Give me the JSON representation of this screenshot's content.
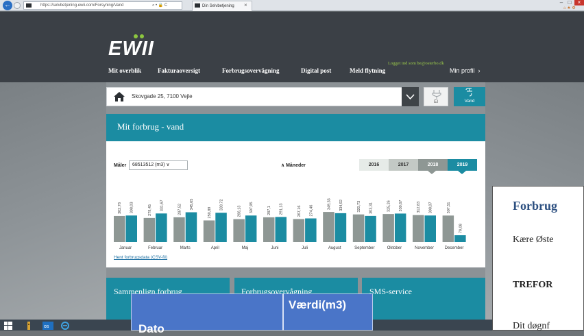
{
  "browser": {
    "url": "https://selvbetjening.ewii.com/Forsyning/Vand",
    "url_controls": "⌕ • 🔒 C",
    "tab_title": "Din Selvbetjening",
    "tab_close": "×"
  },
  "header": {
    "logo": "EWII",
    "nav": [
      "Mit overblik",
      "Fakturaoversigt",
      "Forbrugsovervågning",
      "Digital post",
      "Meld flytning"
    ],
    "login_text": "Logget ind som be@osterbo.dk",
    "profile": "Min profil",
    "profile_chevron": "›"
  },
  "address": {
    "text": "Skovgade 25, 7100 Vejle",
    "el_label": "El",
    "vand_label": "Vand"
  },
  "panel": {
    "title": "Mit forbrug - vand",
    "maaler_label": "Måler",
    "maaler_value": "68513512 (m3) ∨",
    "maaneder": "∧ Måneder",
    "years": [
      "2016",
      "2017",
      "2018",
      "2019"
    ],
    "csv_link": "Hent forbrugsdata (CSV-fil)"
  },
  "colors": {
    "teal": "#1b8ca2",
    "gray_bar": "#8e9794",
    "year_2016_bg": "#e6ebe8",
    "year_2017_bg": "#c3c9c5",
    "year_2018_bg": "#8e9794",
    "year_2019_bg": "#1b8ca2"
  },
  "chart_data": {
    "type": "bar",
    "categories": [
      "Januar",
      "Februar",
      "Marts",
      "April",
      "Maj",
      "Juni",
      "Juli",
      "August",
      "September",
      "Oktober",
      "November",
      "December"
    ],
    "series": [
      {
        "values": [
          302.78,
          279.45,
          287.52,
          250.89,
          266.13,
          287.1,
          267.16,
          349.33,
          320.73,
          325.26,
          312.83,
          307.51
        ]
      },
      {
        "values": [
          308.03,
          331.67,
          345.65,
          339.72,
          307.95,
          291.13,
          274.46,
          334.92,
          303.31,
          330.67,
          308.07,
          79.08
        ]
      }
    ],
    "data_labels": {
      "series_0": [
        "302,78",
        "279,45",
        "287,52",
        "250,89",
        "266,13",
        "287,1",
        "267,16",
        "349,33",
        "320,73",
        "325,26",
        "312,83",
        "307,51"
      ],
      "series_1": [
        "308,03",
        "331,67",
        "345,65",
        "339,72",
        "307,95",
        "291,13",
        "274,46",
        "334,92",
        "303,31",
        "330,67",
        "308,07",
        "79,08"
      ]
    },
    "title": "",
    "xlabel": "",
    "ylabel": "",
    "ylim": [
      0,
      360
    ],
    "grid": false
  },
  "tiles": [
    "Sammenlign forbrug",
    "Forbrugsovervågning",
    "SMS-service"
  ],
  "popup": {
    "heading": "Forbrug",
    "line1": "Kære Øste",
    "line2": "TREFOR",
    "line3": "Dit døgnf"
  },
  "table_fragment": {
    "col1": "Dato",
    "col2": "Værdi(m3)"
  },
  "window": {
    "minimize": "–",
    "maximize": "□",
    "close": "×"
  }
}
